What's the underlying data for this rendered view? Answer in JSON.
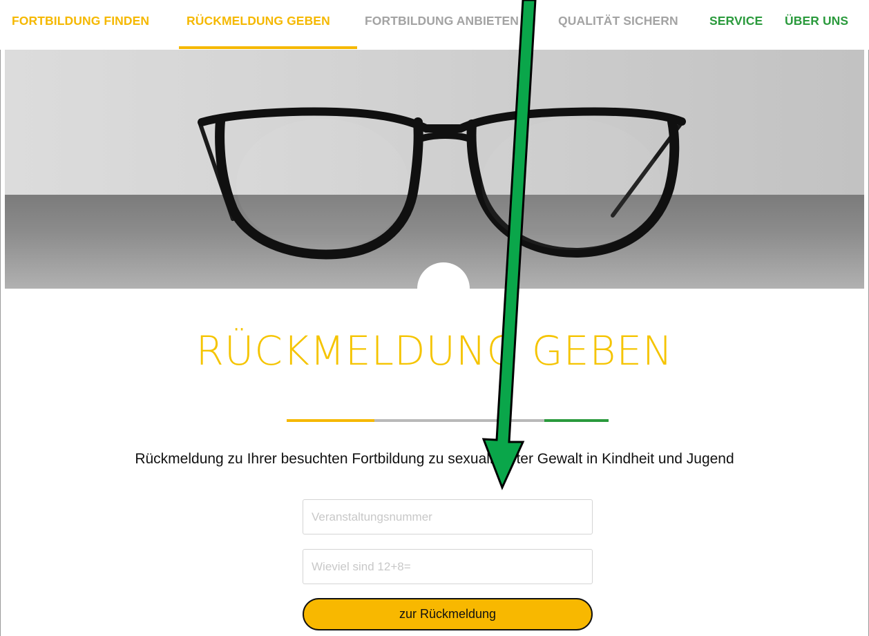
{
  "nav": {
    "items": [
      {
        "label": "FORTBILDUNG FINDEN",
        "color": "#f5b800"
      },
      {
        "label": "RÜCKMELDUNG GEBEN",
        "color": "#f5b800",
        "active": true
      },
      {
        "label": "FORTBILDUNG ANBIETEN",
        "color": "#a3a3a3"
      },
      {
        "label": "QUALITÄT SICHERN",
        "color": "#a3a3a3"
      },
      {
        "label": "SERVICE",
        "color": "#2a9a3c"
      },
      {
        "label": "ÜBER UNS",
        "color": "#2a9a3c"
      }
    ]
  },
  "hero": {
    "image": "glasses-photo"
  },
  "main": {
    "title": "RÜCKMELDUNG GEBEN",
    "subtitle": "Rückmeldung zu Ihrer besuchten Fortbildung zu sexualisierter Gewalt in Kindheit und Jugend",
    "divider_colors": [
      "#f5b800",
      "#b9b9b9",
      "#2a9a3c"
    ]
  },
  "form": {
    "event_number": {
      "placeholder": "Veranstaltungsnummer",
      "value": ""
    },
    "captcha": {
      "placeholder": "Wieviel sind 12+8=",
      "value": ""
    },
    "submit_label": "zur Rückmeldung"
  },
  "annotation": {
    "icon": "green-arrow-icon",
    "color": "#0aa64a"
  }
}
